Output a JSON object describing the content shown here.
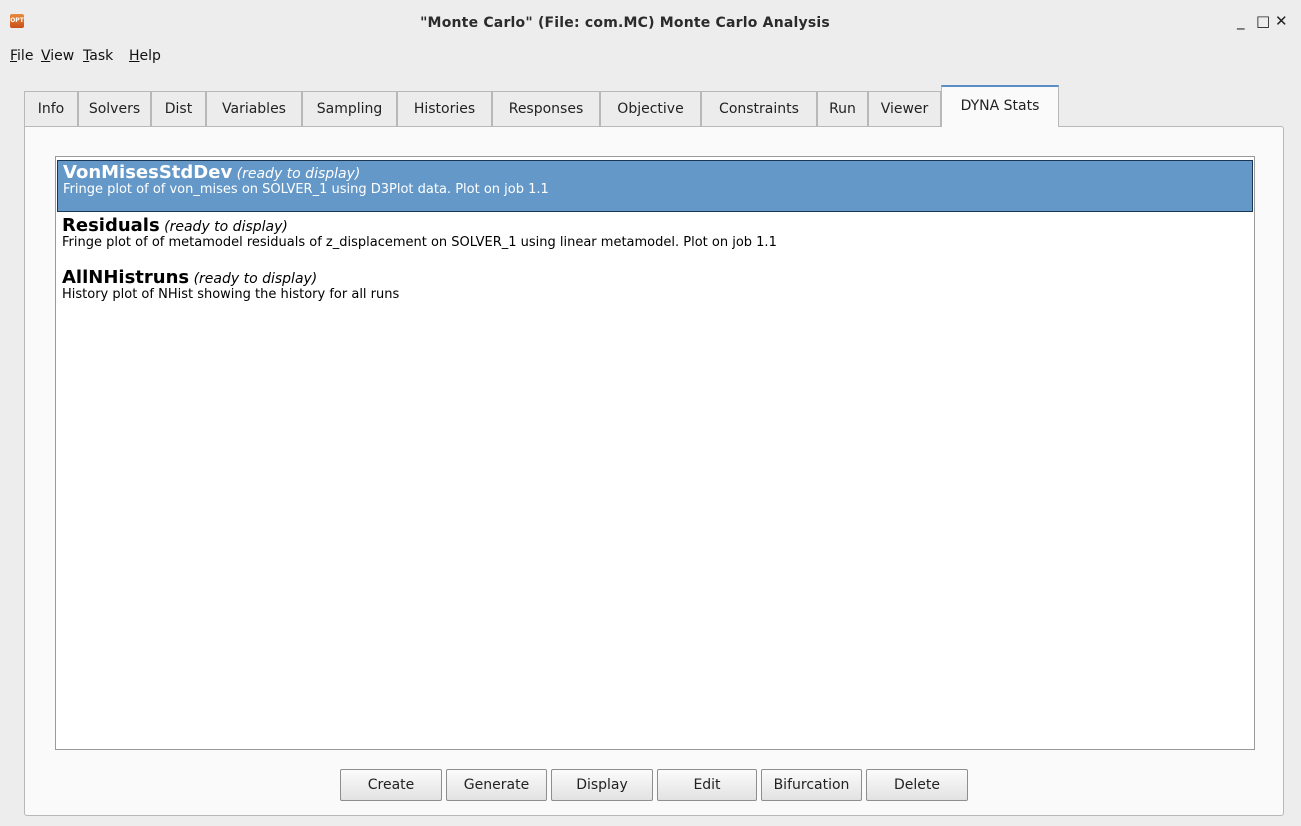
{
  "window": {
    "title": "\"Monte Carlo\" (File: com.MC)  Monte Carlo Analysis",
    "icon_label": "OPT",
    "controls": {
      "minimize": "_",
      "maximize": "□",
      "close": "✕"
    }
  },
  "menu": {
    "items": [
      {
        "accel": "F",
        "rest": "ile"
      },
      {
        "accel": "V",
        "rest": "iew"
      },
      {
        "accel": "T",
        "rest": "ask"
      },
      {
        "accel": "H",
        "rest": "elp"
      }
    ]
  },
  "tabs": [
    "Info",
    "Solvers",
    "Dist",
    "Variables",
    "Sampling",
    "Histories",
    "Responses",
    "Objective",
    "Constraints",
    "Run",
    "Viewer",
    "DYNA Stats"
  ],
  "active_tab": "DYNA Stats",
  "list": {
    "items": [
      {
        "name": "VonMisesStdDev",
        "status": "(ready to display)",
        "description": "Fringe plot of of von_mises on SOLVER_1 using D3Plot data. Plot on job 1.1",
        "selected": true
      },
      {
        "name": "Residuals",
        "status": "(ready to display)",
        "description": "Fringe plot of of metamodel residuals of z_displacement on SOLVER_1 using linear metamodel. Plot on job 1.1",
        "selected": false
      },
      {
        "name": "AllNHistruns",
        "status": "(ready to display)",
        "description": "History plot of NHist showing the history for all runs",
        "selected": false
      }
    ]
  },
  "buttons": {
    "create": "Create",
    "generate": "Generate",
    "display": "Display",
    "edit": "Edit",
    "bifurcation": "Bifurcation",
    "delete": "Delete"
  },
  "colors": {
    "selection_bg": "#6498c8",
    "active_tab_accent": "#5a8fc6"
  }
}
